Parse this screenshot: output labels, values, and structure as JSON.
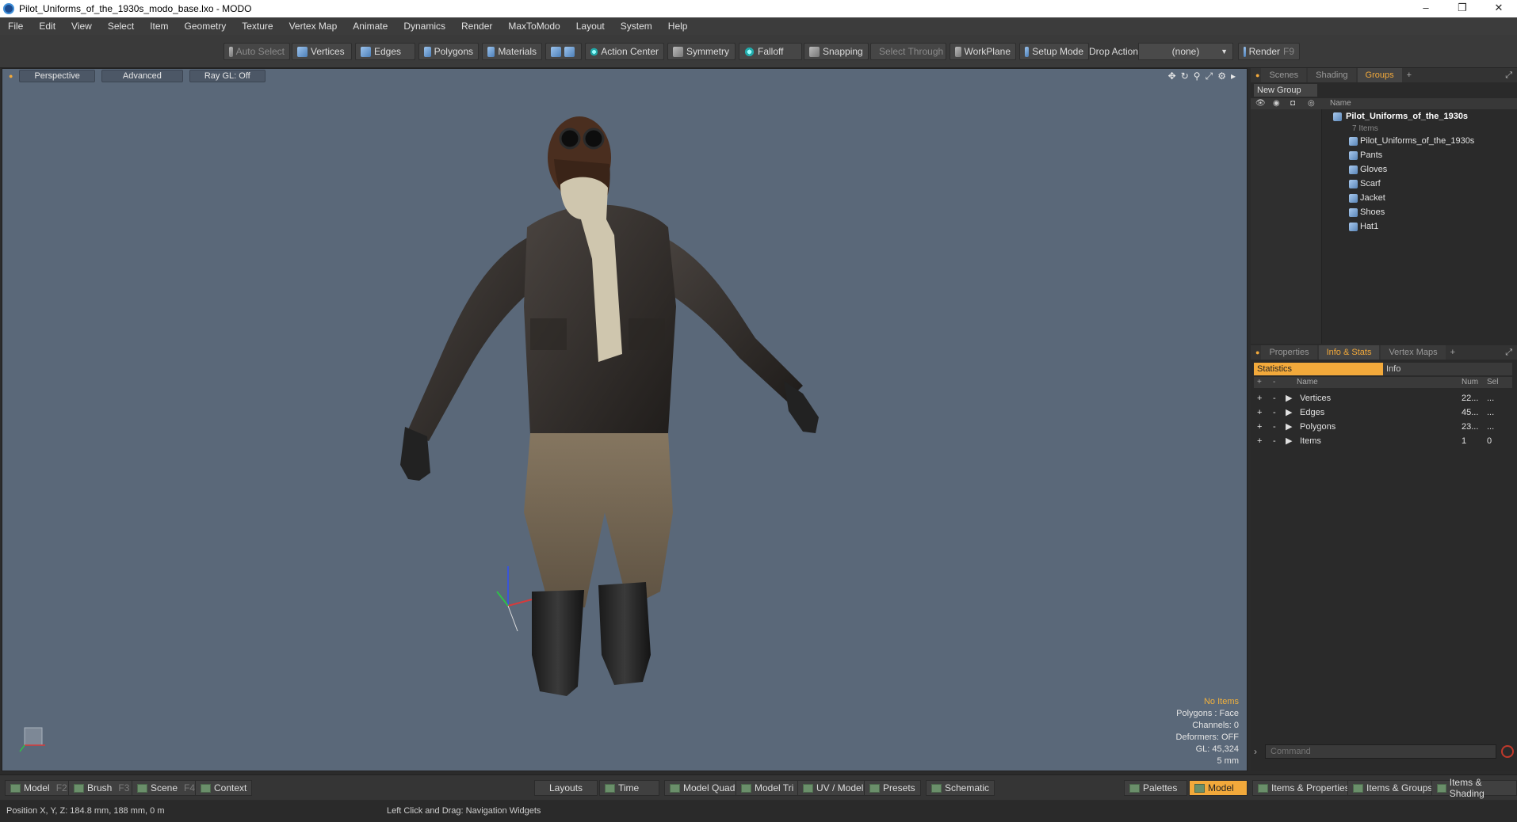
{
  "window": {
    "title": "Pilot_Uniforms_of_the_1930s_modo_base.lxo - MODO",
    "minimize": "–",
    "restore": "❐",
    "close": "✕"
  },
  "menu": [
    "File",
    "Edit",
    "View",
    "Select",
    "Item",
    "Geometry",
    "Texture",
    "Vertex Map",
    "Animate",
    "Dynamics",
    "Render",
    "MaxToModo",
    "Layout",
    "System",
    "Help"
  ],
  "toolbar": {
    "auto_select": "Auto Select",
    "vertices": "Vertices",
    "edges": "Edges",
    "polygons": "Polygons",
    "materials": "Materials",
    "action_center": "Action Center",
    "symmetry": "Symmetry",
    "falloff": "Falloff",
    "snapping": "Snapping",
    "select_through": "Select Through",
    "workplane": "WorkPlane",
    "setup_mode": "Setup Mode",
    "drop_action": "Drop Action",
    "drop_action_value": "(none)",
    "render": "Render",
    "render_key": "F9"
  },
  "viewport": {
    "view_mode": "Perspective",
    "shading": "Advanced",
    "raygl": "Ray GL: Off",
    "info": {
      "selection": "No Items",
      "polygons": "Polygons : Face",
      "channels": "Channels: 0",
      "deformers": "Deformers: OFF",
      "gl": "GL: 45,324",
      "grid": "5 mm"
    }
  },
  "groups_panel": {
    "tabs": [
      "Scenes",
      "Shading",
      "Groups"
    ],
    "active_tab": "Groups",
    "new_group": "New Group",
    "column_name": "Name",
    "root": "Pilot_Uniforms_of_the_1930s",
    "root_count": "7 Items",
    "items": [
      "Pilot_Uniforms_of_the_1930s",
      "Pants",
      "Gloves",
      "Scarf",
      "Jacket",
      "Shoes",
      "Hat1"
    ]
  },
  "info_panel": {
    "tabs": [
      "Properties",
      "Info & Stats",
      "Vertex Maps"
    ],
    "active_tab": "Info & Stats",
    "sub_tabs": [
      "Statistics",
      "Info"
    ],
    "columns": {
      "name": "Name",
      "num": "Num",
      "sel": "Sel"
    },
    "rows": [
      {
        "name": "Vertices",
        "num": "22...",
        "sel": "..."
      },
      {
        "name": "Edges",
        "num": "45...",
        "sel": "..."
      },
      {
        "name": "Polygons",
        "num": "23...",
        "sel": "..."
      },
      {
        "name": "Items",
        "num": "1",
        "sel": "0"
      }
    ],
    "command_placeholder": "Command"
  },
  "bottom_tabs": {
    "model": "Model",
    "model_key": "F2",
    "brush": "Brush",
    "brush_key": "F3",
    "scene": "Scene",
    "scene_key": "F4",
    "context": "Context",
    "layouts": "Layouts",
    "time": "Time",
    "model_quad": "Model Quad",
    "model_tri": "Model Tri",
    "uv_model": "UV / Model",
    "presets": "Presets",
    "schematic": "Schematic",
    "palettes": "Palettes",
    "model_active": "Model",
    "items_properties": "Items & Properties",
    "items_groups": "Items & Groups",
    "items_shading": "Items & Shading"
  },
  "status": {
    "position": "Position X, Y, Z:   184.8 mm, 188 mm, 0 m",
    "hint": "Left Click and Drag:   Navigation Widgets"
  },
  "colors": {
    "accent": "#f2a93b",
    "viewport_bg": "#5a6879"
  }
}
